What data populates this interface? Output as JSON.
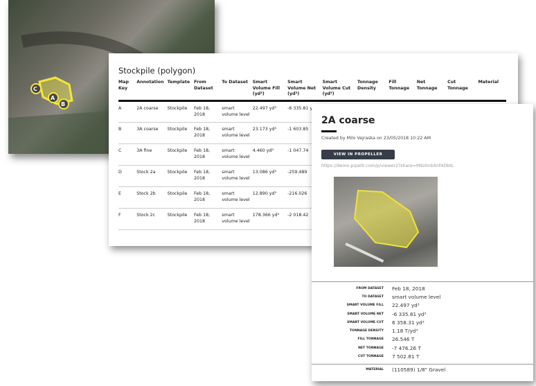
{
  "map": {
    "labels": [
      "A",
      "B",
      "C"
    ]
  },
  "table": {
    "title": "Stockpile (polygon)",
    "headers": [
      "Map Key",
      "Annotation",
      "Template",
      "From Dataset",
      "To Dataset",
      "Smart Volume Fill (yd³)",
      "Smart Volume Net (yd³)",
      "Smart Volume Cut (yd³)",
      "Tonnage Density",
      "Fill Tonnage",
      "Net Tonnage",
      "Cut Tonnage",
      "Material"
    ],
    "rows": [
      [
        "A",
        "2A coarse",
        "Stockpile",
        "Feb 18, 2018",
        "smart volume level",
        "22.497 yd³",
        "-6 335.81 yd³",
        "6 358.31 yd³",
        "1.18 T/yd³",
        "26.546 T",
        "-7 476.26",
        "7 502.81",
        "(110589)"
      ],
      [
        "B",
        "3A coarse",
        "Stockpile",
        "Feb 18, 2018",
        "smart volume level",
        "23.173 yd³",
        "-1 603.85",
        "",
        "",
        "",
        "",
        "",
        ""
      ],
      [
        "C",
        "3A fine",
        "Stockpile",
        "Feb 18, 2018",
        "smart volume level",
        "4.460 yd³",
        "-1 047.74",
        "",
        "",
        "",
        "",
        "",
        ""
      ],
      [
        "D",
        "Stock 2a",
        "Stockpile",
        "Feb 18, 2018",
        "smart volume level",
        "13.086 yd³",
        "-259.489",
        "",
        "",
        "",
        "",
        "",
        ""
      ],
      [
        "E",
        "Stock 2b",
        "Stockpile",
        "Feb 18, 2018",
        "smart volume level",
        "12.890 yd³",
        "-216.026",
        "",
        "",
        "",
        "",
        "",
        ""
      ],
      [
        "F",
        "Stock 2c",
        "Stockpile",
        "Feb 18, 2018",
        "smart volume level",
        "178.366 yd³",
        "-2 018.42",
        "",
        "",
        "",
        "",
        "",
        ""
      ]
    ]
  },
  "detail": {
    "title": "2A coarse",
    "created": "Created by Milo Vejraska on 23/05/2018 10:22 AM",
    "button": "VIEW IN PROPELLER",
    "link": "https://demo.prpellr.com/p/viewer2?share=M9z0nbXnf4DbtL",
    "props": [
      {
        "k": "From dataset",
        "v": "Feb 18, 2018"
      },
      {
        "k": "To dataset",
        "v": "smart volume level"
      },
      {
        "k": "Smart volume fill",
        "v": "22.497 yd³"
      },
      {
        "k": "Smart volume net",
        "v": "-6 335.81 yd³"
      },
      {
        "k": "Smart volume cut",
        "v": "6 358.31 yd³"
      },
      {
        "k": "Tonnage density",
        "v": "1.18 T/yd³"
      },
      {
        "k": "Fill tonnage",
        "v": "26.546 T"
      },
      {
        "k": "Net tonnage",
        "v": "-7 476.26 T"
      },
      {
        "k": "Cut tonnage",
        "v": "7 502.81 T"
      }
    ],
    "material": {
      "k": "Material",
      "v": "(110589) 1/8\" Gravel"
    }
  }
}
